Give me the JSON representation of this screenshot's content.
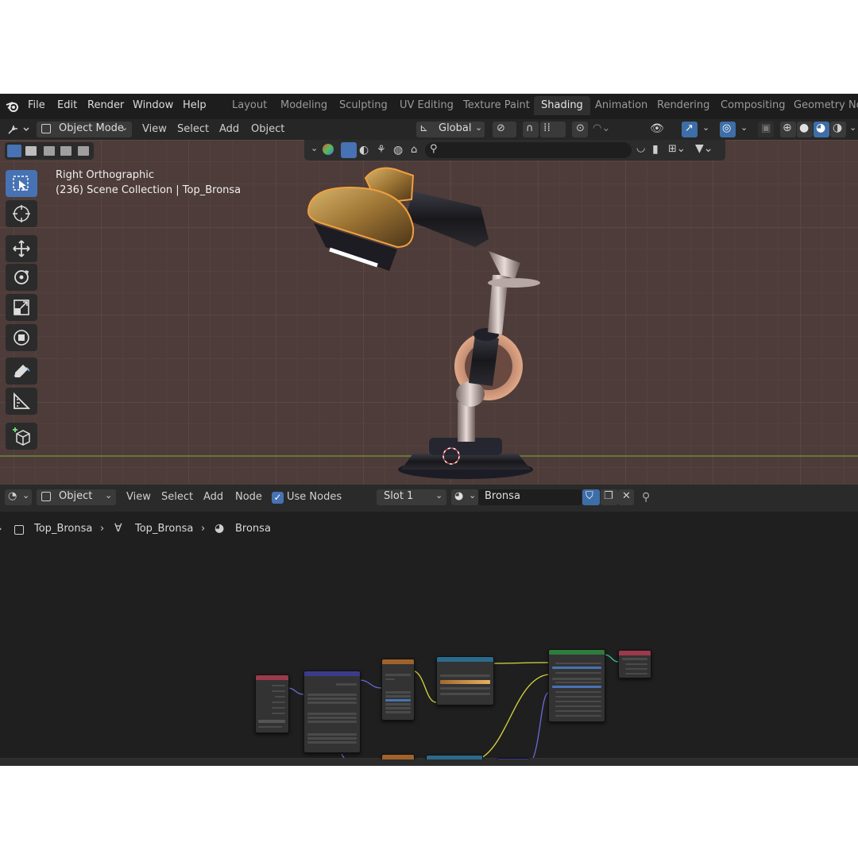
{
  "menu": {
    "items": [
      "File",
      "Edit",
      "Render",
      "Window",
      "Help"
    ]
  },
  "workspaces": {
    "tabs": [
      "Layout",
      "Modeling",
      "Sculpting",
      "UV Editing",
      "Texture Paint",
      "Shading",
      "Animation",
      "Rendering",
      "Compositing",
      "Geometry Noc"
    ],
    "active": "Shading"
  },
  "viewport_header": {
    "mode": "Object Mode",
    "menus": [
      "View",
      "Select",
      "Add",
      "Object"
    ],
    "transform_orientation": "Global"
  },
  "viewport": {
    "view_name": "Right Orthographic",
    "collection_info": "(236) Scene Collection | Top_Bronsa"
  },
  "node_header": {
    "editor_type": "Object",
    "menus": [
      "View",
      "Select",
      "Add",
      "Node"
    ],
    "use_nodes_label": "Use Nodes",
    "use_nodes_checked": true,
    "slot": "Slot 1",
    "material": "Bronsa"
  },
  "breadcrumb": {
    "object": "Top_Bronsa",
    "mesh": "Top_Bronsa",
    "material": "Bronsa"
  },
  "colors": {
    "accent": "#4772b3",
    "viewport_bg": "#4d3c39",
    "node_editor_bg": "#1f1f1f",
    "selection_outline": "#f0a040"
  }
}
